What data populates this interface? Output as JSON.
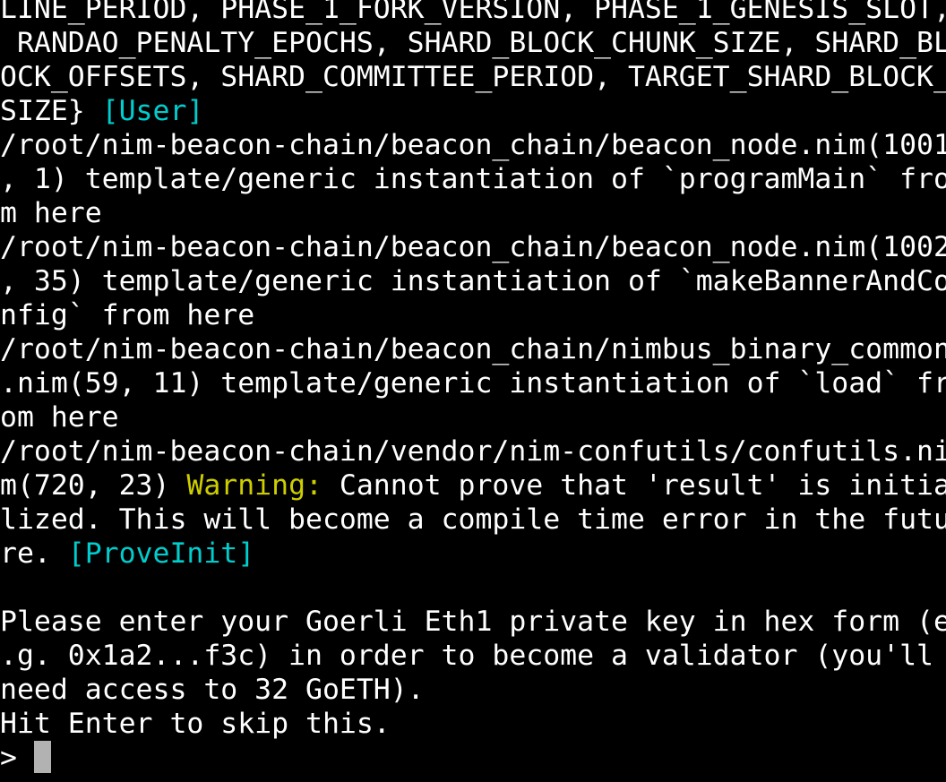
{
  "terminal": {
    "type": "tty-console",
    "background_color": "#000000",
    "foreground_color": "#ffffff",
    "cursor_color": "#b2b2b2",
    "colors": {
      "white": "#ffffff",
      "cyan": "#00cdcd",
      "yellow": "#cdcd00"
    },
    "columns": 56,
    "lines": [
      {
        "id": "line-01",
        "segments": [
          {
            "text": "LINE_PERIOD, PHASE_1_FORK_VERSION, PHASE_1_GENESIS_SLOT,",
            "color": "white"
          }
        ]
      },
      {
        "id": "line-02",
        "segments": [
          {
            "text": " RANDAO_PENALTY_EPOCHS, SHARD_BLOCK_CHUNK_SIZE, SHARD_BL",
            "color": "white"
          }
        ]
      },
      {
        "id": "line-03",
        "segments": [
          {
            "text": "OCK_OFFSETS, SHARD_COMMITTEE_PERIOD, TARGET_SHARD_BLOCK_",
            "color": "white"
          }
        ]
      },
      {
        "id": "line-04",
        "segments": [
          {
            "text": "SIZE} ",
            "color": "white"
          },
          {
            "text": "[User]",
            "color": "cyan"
          }
        ]
      },
      {
        "id": "line-05",
        "segments": [
          {
            "text": "/root/nim-beacon-chain/beacon_chain/beacon_node.nim(1001",
            "color": "white"
          }
        ]
      },
      {
        "id": "line-06",
        "segments": [
          {
            "text": ", 1) template/generic instantiation of `programMain` fro",
            "color": "white"
          }
        ]
      },
      {
        "id": "line-07",
        "segments": [
          {
            "text": "m here",
            "color": "white"
          }
        ]
      },
      {
        "id": "line-08",
        "segments": [
          {
            "text": "/root/nim-beacon-chain/beacon_chain/beacon_node.nim(1002",
            "color": "white"
          }
        ]
      },
      {
        "id": "line-09",
        "segments": [
          {
            "text": ", 35) template/generic instantiation of `makeBannerAndCo",
            "color": "white"
          }
        ]
      },
      {
        "id": "line-10",
        "segments": [
          {
            "text": "nfig` from here",
            "color": "white"
          }
        ]
      },
      {
        "id": "line-11",
        "segments": [
          {
            "text": "/root/nim-beacon-chain/beacon_chain/nimbus_binary_common",
            "color": "white"
          }
        ]
      },
      {
        "id": "line-12",
        "segments": [
          {
            "text": ".nim(59, 11) template/generic instantiation of `load` fr",
            "color": "white"
          }
        ]
      },
      {
        "id": "line-13",
        "segments": [
          {
            "text": "om here",
            "color": "white"
          }
        ]
      },
      {
        "id": "line-14",
        "segments": [
          {
            "text": "/root/nim-beacon-chain/vendor/nim-confutils/confutils.ni",
            "color": "white"
          }
        ]
      },
      {
        "id": "line-15",
        "segments": [
          {
            "text": "m(720, 23) ",
            "color": "white"
          },
          {
            "text": "Warning:",
            "color": "yellow"
          },
          {
            "text": " Cannot prove that 'result' is initia",
            "color": "white"
          }
        ]
      },
      {
        "id": "line-16",
        "segments": [
          {
            "text": "lized. This will become a compile time error in the futu",
            "color": "white"
          }
        ]
      },
      {
        "id": "line-17",
        "segments": [
          {
            "text": "re. ",
            "color": "white"
          },
          {
            "text": "[ProveInit]",
            "color": "cyan"
          }
        ]
      },
      {
        "id": "line-18",
        "segments": []
      },
      {
        "id": "line-19",
        "segments": [
          {
            "text": "Please enter your Goerli Eth1 private key in hex form (e",
            "color": "white"
          }
        ]
      },
      {
        "id": "line-20",
        "segments": [
          {
            "text": ".g. 0x1a2...f3c) in order to become a validator (you'll ",
            "color": "white"
          }
        ]
      },
      {
        "id": "line-21",
        "segments": [
          {
            "text": "need access to 32 GoETH).",
            "color": "white"
          }
        ]
      },
      {
        "id": "line-22",
        "segments": [
          {
            "text": "Hit Enter to skip this.",
            "color": "white"
          }
        ]
      },
      {
        "id": "line-23",
        "prompt": true,
        "segments": [
          {
            "text": "> ",
            "color": "white"
          }
        ],
        "cursor": true,
        "input_value": ""
      }
    ]
  }
}
